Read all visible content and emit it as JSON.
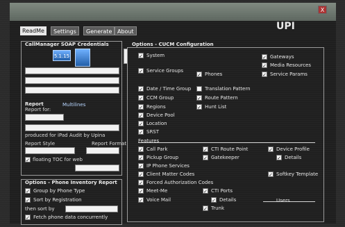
{
  "window": {
    "title": "",
    "brand": "UPI",
    "buttons": {
      "close": "X"
    }
  },
  "tabs": [
    {
      "label": "ReadMe"
    },
    {
      "label": "Settings"
    },
    {
      "label": "Generate"
    },
    {
      "label": "About"
    }
  ],
  "left": {
    "creds_title": "CallManager SOAP Credentials",
    "version_chips": [
      "5.1.15"
    ],
    "report_title_group": "Report",
    "report_for_label": "Report for:",
    "link1": "Multilines",
    "report_style_label": "Report Style",
    "report_format_label": "Report Format",
    "floating_toc_label": "floating TOC for web",
    "produced_for_label": "produced for iPad Audit by Upina"
  },
  "phone_inventory": {
    "title": "Options - Phone Inventory Report",
    "items": [
      {
        "label": "Group by Phone Type",
        "checked": true
      },
      {
        "label": "Sort by Registration",
        "checked": true
      },
      {
        "label": "then sort by",
        "checked": false
      },
      {
        "label": "Fetch phone data concurrently",
        "checked": true
      }
    ]
  },
  "options": {
    "title": "Options - CUCM Configuration",
    "col1": [
      {
        "label": "System",
        "checked": true
      },
      {
        "label": "Service Groups",
        "checked": true
      },
      {
        "label": "Date / Time Group",
        "checked": true
      },
      {
        "label": "CCM Group",
        "checked": true
      },
      {
        "label": "Regions",
        "checked": true
      },
      {
        "label": "Device Pool",
        "checked": true
      },
      {
        "label": "Location",
        "checked": true
      },
      {
        "label": "SRST",
        "checked": true
      }
    ],
    "col2": [
      {
        "label": "Phones",
        "checked": true
      },
      {
        "label": "Translation Pattern",
        "checked": false
      },
      {
        "label": "Route Pattern",
        "checked": true
      },
      {
        "label": "Hunt List",
        "checked": true
      }
    ],
    "col3": [
      {
        "label": "Gateways",
        "checked": true
      },
      {
        "label": "Media Resources",
        "checked": true
      },
      {
        "label": "Service Params",
        "checked": true
      }
    ],
    "features_section_label": "Features",
    "features": [
      {
        "label": "Call Park",
        "checked": true,
        "col": 1
      },
      {
        "label": "Pickup Group",
        "checked": true,
        "col": 1
      },
      {
        "label": "IP Phone Services",
        "checked": true,
        "col": 1
      },
      {
        "label": "Client Matter Codes",
        "checked": true,
        "col": 1
      },
      {
        "label": "Forced Authorization Codes",
        "checked": true,
        "col": 1
      },
      {
        "label": "Meet-Me",
        "checked": true,
        "col": 1
      },
      {
        "label": "Voice Mail",
        "checked": true,
        "col": 1
      },
      {
        "label": "CTI Route Point",
        "checked": true,
        "col": 2
      },
      {
        "label": "Gatekeeper",
        "checked": true,
        "col": 2
      },
      {
        "label": "CTI Ports",
        "checked": true,
        "col": 2
      },
      {
        "label": "Details",
        "checked": true,
        "col": 2
      },
      {
        "label": "Trunk",
        "checked": true,
        "col": 2
      },
      {
        "label": "Device Profile",
        "checked": true,
        "col": 3
      },
      {
        "label": "Details",
        "checked": true,
        "col": 3
      },
      {
        "label": "Softkey Template",
        "checked": true,
        "col": 3
      }
    ],
    "users_label": "Users"
  }
}
